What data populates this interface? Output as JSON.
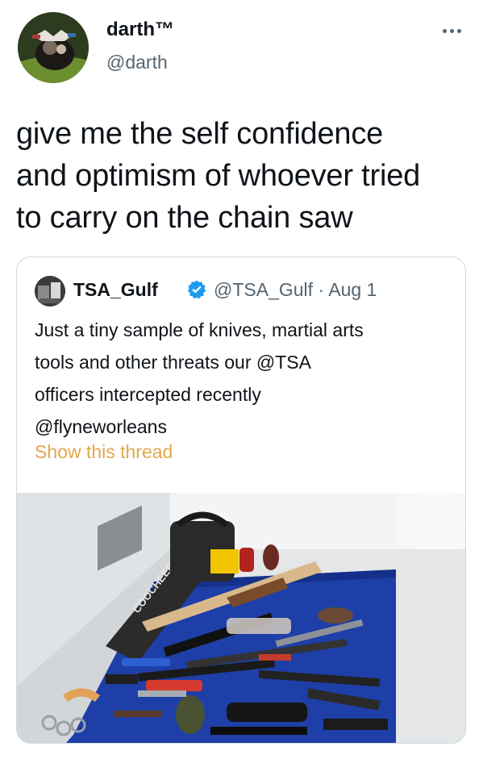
{
  "tweet": {
    "author_name": "darth™",
    "author_handle": "@darth",
    "text": "give me the self confidence\nand optimism of whoever tried\nto carry on the chain saw"
  },
  "quoted_tweet": {
    "author_name": "TSA_Gulf",
    "verified": true,
    "meta": "@TSA_Gulf · Aug 1",
    "text": "Just a tiny sample of knives, martial arts\ntools and other threats our @TSA\nofficers intercepted recently\n@flyneworleans",
    "show_thread": "Show this thread",
    "photo_caption_brand": "COOCHEER"
  },
  "icons": [
    "more-options-icon",
    "verified-badge-icon"
  ],
  "colors": {
    "link": "#e0a84c",
    "secondary_text": "#536471",
    "border": "#cfd9de",
    "verified": "#1d9bf0",
    "table_blue": "#1e3fa8"
  }
}
